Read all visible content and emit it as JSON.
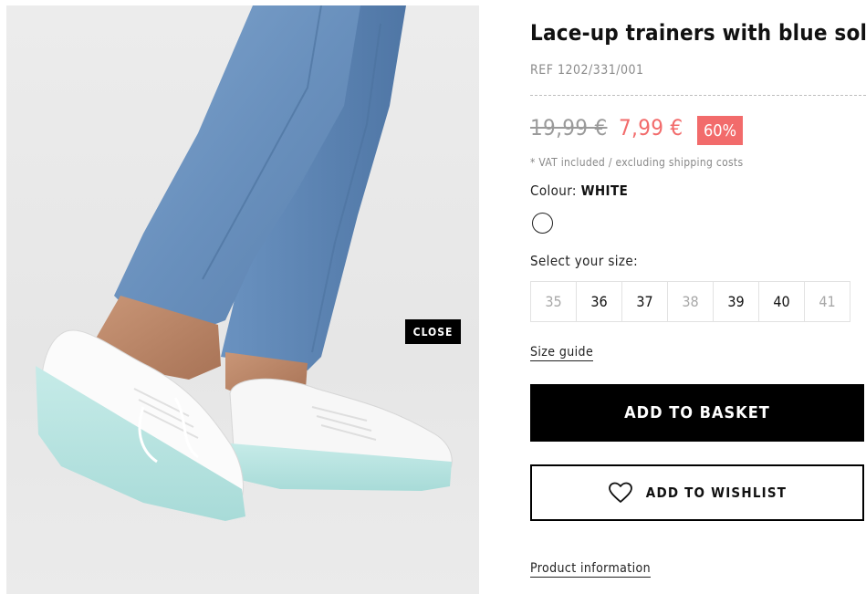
{
  "product": {
    "title": "Lace-up trainers with blue soles",
    "ref": "REF 1202/331/001",
    "old_price": "19,99 €",
    "new_price": "7,99 €",
    "discount": "60%",
    "vat_note": "* VAT included / excluding shipping costs"
  },
  "colour": {
    "label": "Colour:",
    "value": "WHITE",
    "swatch_color": "#ffffff"
  },
  "size_selector": {
    "label": "Select your size:",
    "sizes": [
      {
        "label": "35",
        "available": false
      },
      {
        "label": "36",
        "available": true
      },
      {
        "label": "37",
        "available": true
      },
      {
        "label": "38",
        "available": false
      },
      {
        "label": "39",
        "available": true
      },
      {
        "label": "40",
        "available": true
      },
      {
        "label": "41",
        "available": false
      }
    ],
    "guide_label": "Size guide"
  },
  "actions": {
    "basket_label": "ADD TO BASKET",
    "wishlist_label": "ADD TO WISHLIST",
    "wishlist_icon": "heart-icon"
  },
  "links": {
    "product_info": "Product information"
  },
  "gallery": {
    "close_label": "CLOSE"
  },
  "colors": {
    "sale": "#f26b6b",
    "primary": "#000000",
    "muted": "#8a8a8a"
  }
}
